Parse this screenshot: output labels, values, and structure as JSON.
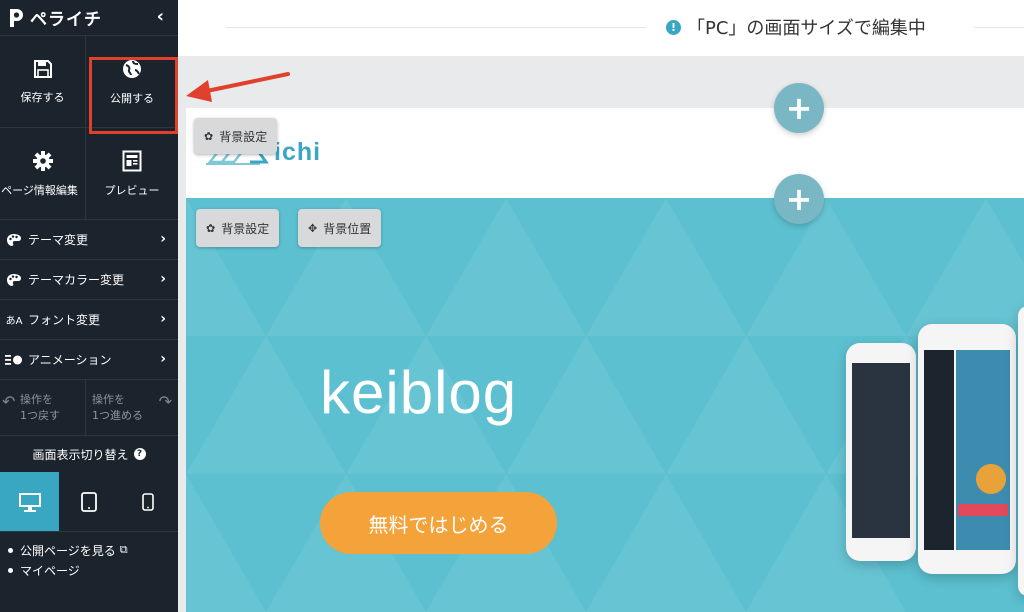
{
  "sidebar": {
    "brand": "ペライチ",
    "collapse_icon": "chevron-left-icon",
    "tiles": [
      {
        "label": "保存する",
        "icon": "floppy-disk-icon"
      },
      {
        "label": "公開する",
        "icon": "globe-icon"
      },
      {
        "label": "ページ情報編集",
        "icon": "gear-icon"
      },
      {
        "label": "プレビュー",
        "icon": "document-icon"
      }
    ],
    "menu": [
      {
        "label": "テーマ変更",
        "icon": "palette-icon"
      },
      {
        "label": "テーマカラー変更",
        "icon": "palette-icon"
      },
      {
        "label": "フォント変更",
        "icon": "font-icon",
        "icon_text": "あA"
      },
      {
        "label": "アニメーション",
        "icon": "animation-icon"
      }
    ],
    "undo": {
      "line1": "操作を",
      "line2": "1つ戻す"
    },
    "redo": {
      "line1": "操作を",
      "line2": "1つ進める"
    },
    "view_switch_title": "画面表示切り替え",
    "views": [
      {
        "name": "desktop",
        "active": true
      },
      {
        "name": "tablet",
        "active": false
      },
      {
        "name": "mobile",
        "active": false
      }
    ],
    "links": [
      {
        "label": "公開ページを見る"
      },
      {
        "label": "マイページ"
      }
    ]
  },
  "topbar": {
    "notice": "「PC」の画面サイズで編集中"
  },
  "editor": {
    "header_logo_text": "ichi",
    "bg_settings_label": "背景設定",
    "bg_position_label": "背景位置",
    "add_section_symbol": "+",
    "hero_title": "keiblog",
    "hero_cta": "無料ではじめる"
  },
  "colors": {
    "sidebar_bg": "#1b232c",
    "accent": "#3aa7c2",
    "hero_bg": "#5cc0d0",
    "cta": "#f4a23a",
    "highlight": "#e0412d"
  }
}
